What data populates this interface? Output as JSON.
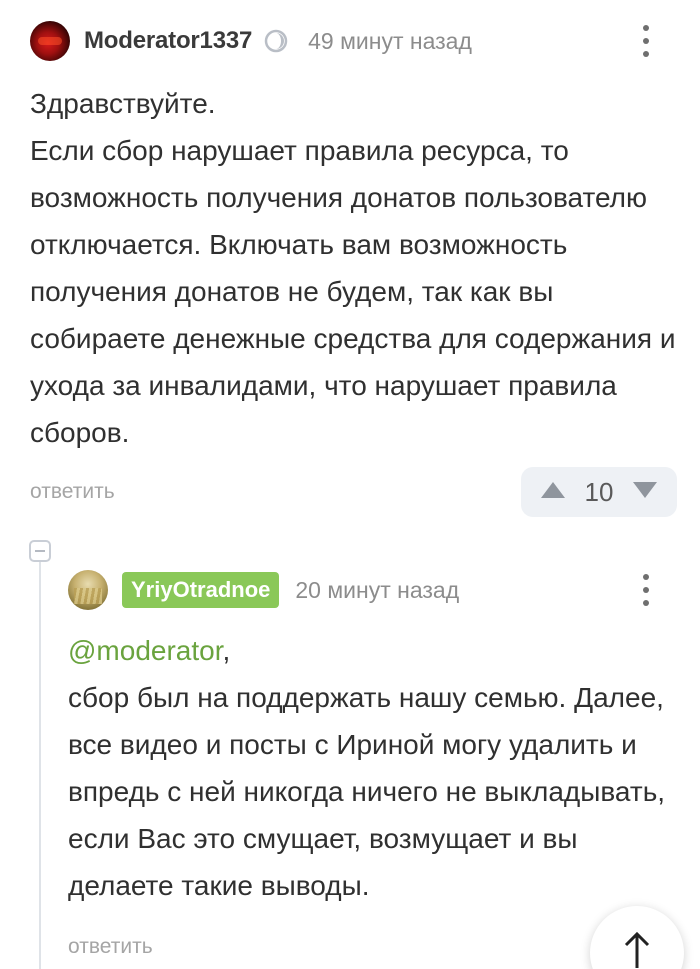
{
  "comment": {
    "author": "Moderator1337",
    "time": "49 минут назад",
    "lines": [
      "Здравствуйте.",
      "Если сбор нарушает правила ресурса, то возможность получения донатов пользователю отключается. Включать вам возможность получения донатов не будем, так как вы собираете денежные средства для содержания и ухода за инвалидами, что нарушает правила сборов."
    ],
    "reply_label": "ответить",
    "rating": "10",
    "menu_icon": "more-vertical-icon",
    "badge_icon": "moderator-badge-icon"
  },
  "reply": {
    "author": "YriyOtradnoe",
    "author_tag_color": "#8ac858",
    "time": "20 минут назад",
    "mention": "@moderator",
    "mention_suffix": ",",
    "text": "сбор был на поддержать нашу семью. Далее, все видео и посты с Ириной могу удалить и впредь с ней никогда ничего не выкладывать, если Вас это смущает, возмущает и вы делаете такие выводы.",
    "reply_label": "ответить",
    "menu_icon": "more-vertical-icon"
  },
  "colors": {
    "accent_green": "#6aa33e",
    "muted_text": "#a5a5a5",
    "vote_bg": "#eef1f5"
  },
  "scroll_top_icon": "arrow-up-icon"
}
